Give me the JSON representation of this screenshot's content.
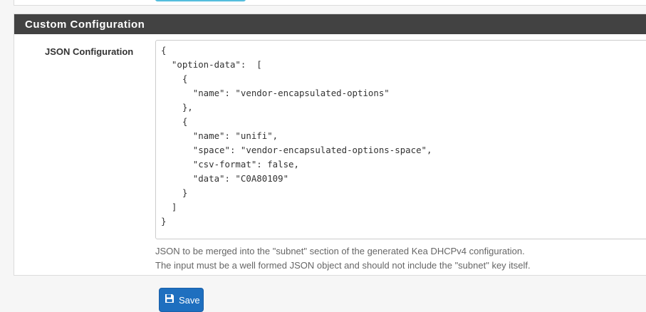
{
  "section": {
    "title": "Custom Configuration"
  },
  "json_config": {
    "label": "JSON Configuration",
    "value": "{\n  \"option-data\":  [\n    {\n      \"name\": \"vendor-encapsulated-options\"\n    },\n    {\n      \"name\": \"unifi\",\n      \"space\": \"vendor-encapsulated-options-space\",\n      \"csv-format\": false,\n      \"data\": \"C0A80109\"\n    }\n  ]\n}",
    "help_line1": "JSON to be merged into the \"subnet\" section of the generated Kea DHCPv4 configuration.",
    "help_line2": "The input must be a well formed JSON object and should not include the \"subnet\" key itself."
  },
  "actions": {
    "save_label": "Save",
    "save_icon": "floppy-disk-icon"
  },
  "colors": {
    "panel_heading": "#424242",
    "save_button": "#1e6fbf",
    "top_button": "#5bc0de"
  }
}
